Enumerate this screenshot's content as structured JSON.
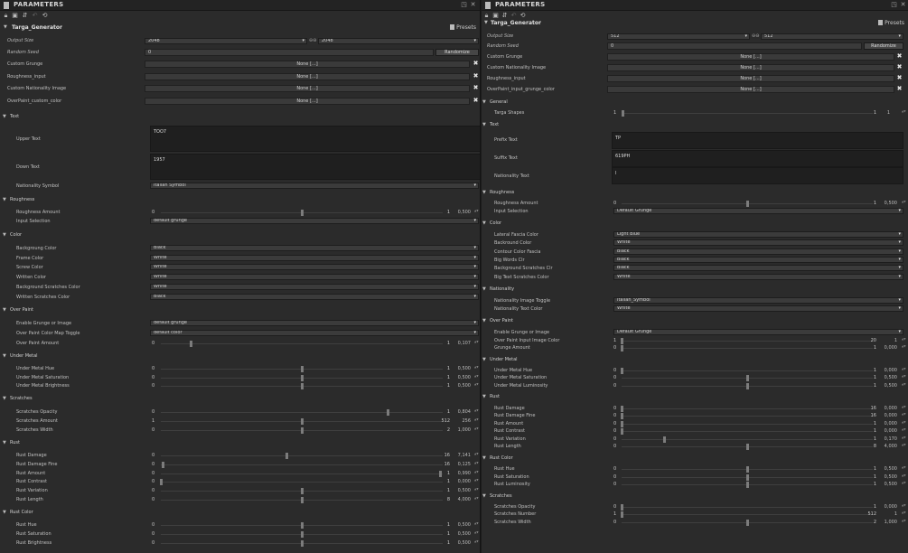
{
  "left": {
    "title": "PARAMETERS",
    "graph": "Targa_Generator",
    "presets": "Presets",
    "output_size_label": "Output Size",
    "output_size_w": "2048",
    "output_size_h": "2048",
    "random_seed_label": "Random Seed",
    "random_seed_value": "0",
    "randomize": "Randomize",
    "none_label": "None [...]",
    "inputs": [
      "Custom Grunge",
      "Roughness_input",
      "Custom Nationality Image",
      "OverPaint_custom_color"
    ],
    "sections": {
      "text": "Text",
      "roughness": "Roughness",
      "color": "Color",
      "overpaint": "Over Paint",
      "undermetal": "Under Metal",
      "scratches": "Scratches",
      "rust": "Rust",
      "rustcolor": "Rust Color"
    },
    "upper_text_label": "Upper Text",
    "upper_text_value": "TOO7",
    "down_text_label": "Down Text",
    "down_text_value": "1957",
    "nationality_symbol_label": "Nationality Symbol",
    "nationality_symbol_value": "Italian Symbol",
    "roughness_amount_label": "Roughness Amount",
    "input_selection_label": "Input Selection",
    "input_selection_value": "default grunge",
    "colors": [
      {
        "label": "Backgroung Color",
        "value": "Black"
      },
      {
        "label": "Frame Color",
        "value": "White"
      },
      {
        "label": "Screw Color",
        "value": "White"
      },
      {
        "label": "Written Color",
        "value": "White"
      },
      {
        "label": "Background Scratches Color",
        "value": "White"
      },
      {
        "label": "Written Scratches Color",
        "value": "Black"
      }
    ],
    "overpaint_grunge_label": "Enable Grunge or Image",
    "overpaint_grunge_value": "default grunge",
    "overpaint_toggle_label": "Over Paint Color Map Toggle",
    "overpaint_toggle_value": "default color",
    "sliders": {
      "roughness_amount": {
        "label": "Roughness Amount",
        "min": "0",
        "max": "1",
        "value": "0,500",
        "pos": 0.5
      },
      "overpaint_amount": {
        "label": "Over Paint Amount",
        "min": "0",
        "max": "1",
        "value": "0,107",
        "pos": 0.107
      },
      "um_hue": {
        "label": "Under Metal  Hue",
        "min": "0",
        "max": "1",
        "value": "0,500",
        "pos": 0.5
      },
      "um_sat": {
        "label": "Under Metal Saturation",
        "min": "0",
        "max": "1",
        "value": "0,500",
        "pos": 0.5
      },
      "um_bri": {
        "label": "Under Metal Brightness",
        "min": "0",
        "max": "1",
        "value": "0,500",
        "pos": 0.5
      },
      "sc_op": {
        "label": "Scratches Opacity",
        "min": "0",
        "max": "1",
        "value": "0,804",
        "pos": 0.804
      },
      "sc_am": {
        "label": "Scratches Amount",
        "min": "1",
        "max": "512",
        "value": "256",
        "pos": 0.5
      },
      "sc_wi": {
        "label": "Scratches Width",
        "min": "0",
        "max": "2",
        "value": "1,000",
        "pos": 0.5
      },
      "ru_dm": {
        "label": "Rust Damage",
        "min": "0",
        "max": "16",
        "value": "7,141",
        "pos": 0.446
      },
      "ru_df": {
        "label": "Rust Damage Fine",
        "min": "0",
        "max": "16",
        "value": "0,125",
        "pos": 0.008
      },
      "ru_am": {
        "label": "Rust Amount",
        "min": "0",
        "max": "1",
        "value": "0,990",
        "pos": 0.99
      },
      "ru_co": {
        "label": "Rust Contrast",
        "min": "0",
        "max": "1",
        "value": "0,000",
        "pos": 0.0
      },
      "ru_va": {
        "label": "Rust Variation",
        "min": "0",
        "max": "1",
        "value": "0,500",
        "pos": 0.5
      },
      "ru_le": {
        "label": "Rust Length",
        "min": "0",
        "max": "8",
        "value": "4,000",
        "pos": 0.5
      },
      "rc_hu": {
        "label": "Rust Hue",
        "min": "0",
        "max": "1",
        "value": "0,500",
        "pos": 0.5
      },
      "rc_sa": {
        "label": "Rust Saturation",
        "min": "0",
        "max": "1",
        "value": "0,500",
        "pos": 0.5
      },
      "rc_br": {
        "label": "Rust Brightness",
        "min": "0",
        "max": "1",
        "value": "0,500",
        "pos": 0.5
      }
    }
  },
  "right": {
    "title": "PARAMETERS",
    "graph": "Targa_Generator",
    "presets": "Presets",
    "output_size_label": "Output Size",
    "output_size_w": "512",
    "output_size_h": "512",
    "random_seed_label": "Random Seed",
    "random_seed_value": "0",
    "randomize": "Randomize",
    "none_label": "None [...]",
    "inputs": [
      "Custom Grunge",
      "Custom Nationality Image",
      "Roughness_input",
      "OverPaint_input_grunge_color"
    ],
    "sections": {
      "general": "General",
      "text": "Text",
      "roughness": "Roughness",
      "color": "Color",
      "nationality": "Nationality",
      "overpaint": "Over Paint",
      "undermetal": "Under Metal",
      "rust": "Rust",
      "rustcolor": "Rust Color",
      "scratches": "Scratches"
    },
    "targa_shapes": {
      "label": "Targa Shapes",
      "min": "1",
      "max": "1",
      "value": "1",
      "pos": 0.0
    },
    "prefix_label": "Prefix Text",
    "prefix_value": "TP",
    "suffix_label": "Suffix Text",
    "suffix_value": "619PH",
    "nat_text_label": "Nationality Text",
    "nat_text_value": "I",
    "rough_amount": {
      "label": "Roughness Amount",
      "min": "0",
      "max": "1",
      "value": "0,500",
      "pos": 0.5
    },
    "input_selection_label": "Input Selection",
    "input_selection_value": "Default Grunge",
    "colors": [
      {
        "label": "Lateral Fascia Color",
        "value": "Light Blue"
      },
      {
        "label": "Backround Color",
        "value": "White"
      },
      {
        "label": "Contour Color Fascia",
        "value": "Black"
      },
      {
        "label": "Big Words Clr",
        "value": "Black"
      },
      {
        "label": "Background Scratches Clr",
        "value": "Black"
      },
      {
        "label": "Big Text Scratches Color",
        "value": "White"
      }
    ],
    "nat_image_toggle_label": "Nationality Image Toggle",
    "nat_image_toggle_value": "Italian_Symbol",
    "nat_text_color_label": "Nationality Text Color",
    "nat_text_color_value": "White",
    "op_grunge_label": "Enable Grunge or Image",
    "op_grunge_value": "Default Grunge",
    "sliders": {
      "op_input": {
        "label": "Over Paint Input Image Color",
        "min": "1",
        "max": "20",
        "value": "1",
        "pos": 0.0
      },
      "op_grunge": {
        "label": "Grunge Amount",
        "min": "0",
        "max": "1",
        "value": "0,000",
        "pos": 0.0
      },
      "um_hue": {
        "label": "Under Metal Hue",
        "min": "0",
        "max": "1",
        "value": "0,000",
        "pos": 0.0
      },
      "um_sat": {
        "label": "Under Metal Saturation",
        "min": "0",
        "max": "1",
        "value": "0,500",
        "pos": 0.5
      },
      "um_lum": {
        "label": "Under Metal Luminosity",
        "min": "0",
        "max": "1",
        "value": "0,500",
        "pos": 0.5
      },
      "ru_dm": {
        "label": "Rust Damage",
        "min": "0",
        "max": "16",
        "value": "0,000",
        "pos": 0.0
      },
      "ru_df": {
        "label": "Rust Damage Fine",
        "min": "0",
        "max": "16",
        "value": "0,000",
        "pos": 0.0
      },
      "ru_am": {
        "label": "Rust Amount",
        "min": "0",
        "max": "1",
        "value": "0,000",
        "pos": 0.0
      },
      "ru_co": {
        "label": "Rust Contrast",
        "min": "0",
        "max": "1",
        "value": "0,000",
        "pos": 0.0
      },
      "ru_va": {
        "label": "Rust Variation",
        "min": "0",
        "max": "1",
        "value": "0,170",
        "pos": 0.17
      },
      "ru_le": {
        "label": "Rust Length",
        "min": "0",
        "max": "8",
        "value": "4,000",
        "pos": 0.5
      },
      "rc_hu": {
        "label": "Rust Hue",
        "min": "0",
        "max": "1",
        "value": "0,500",
        "pos": 0.5
      },
      "rc_sa": {
        "label": "Rust Saturation",
        "min": "0",
        "max": "1",
        "value": "0,500",
        "pos": 0.5
      },
      "rc_lu": {
        "label": "Rust Luminosity",
        "min": "0",
        "max": "1",
        "value": "0,500",
        "pos": 0.5
      },
      "sc_op": {
        "label": "Scratches Opacity",
        "min": "0",
        "max": "1",
        "value": "0,000",
        "pos": 0.0
      },
      "sc_nu": {
        "label": "Scratches Number",
        "min": "1",
        "max": "512",
        "value": "1",
        "pos": 0.0
      },
      "sc_wi": {
        "label": "Scratches Width",
        "min": "0",
        "max": "2",
        "value": "1,000",
        "pos": 0.5
      }
    }
  }
}
